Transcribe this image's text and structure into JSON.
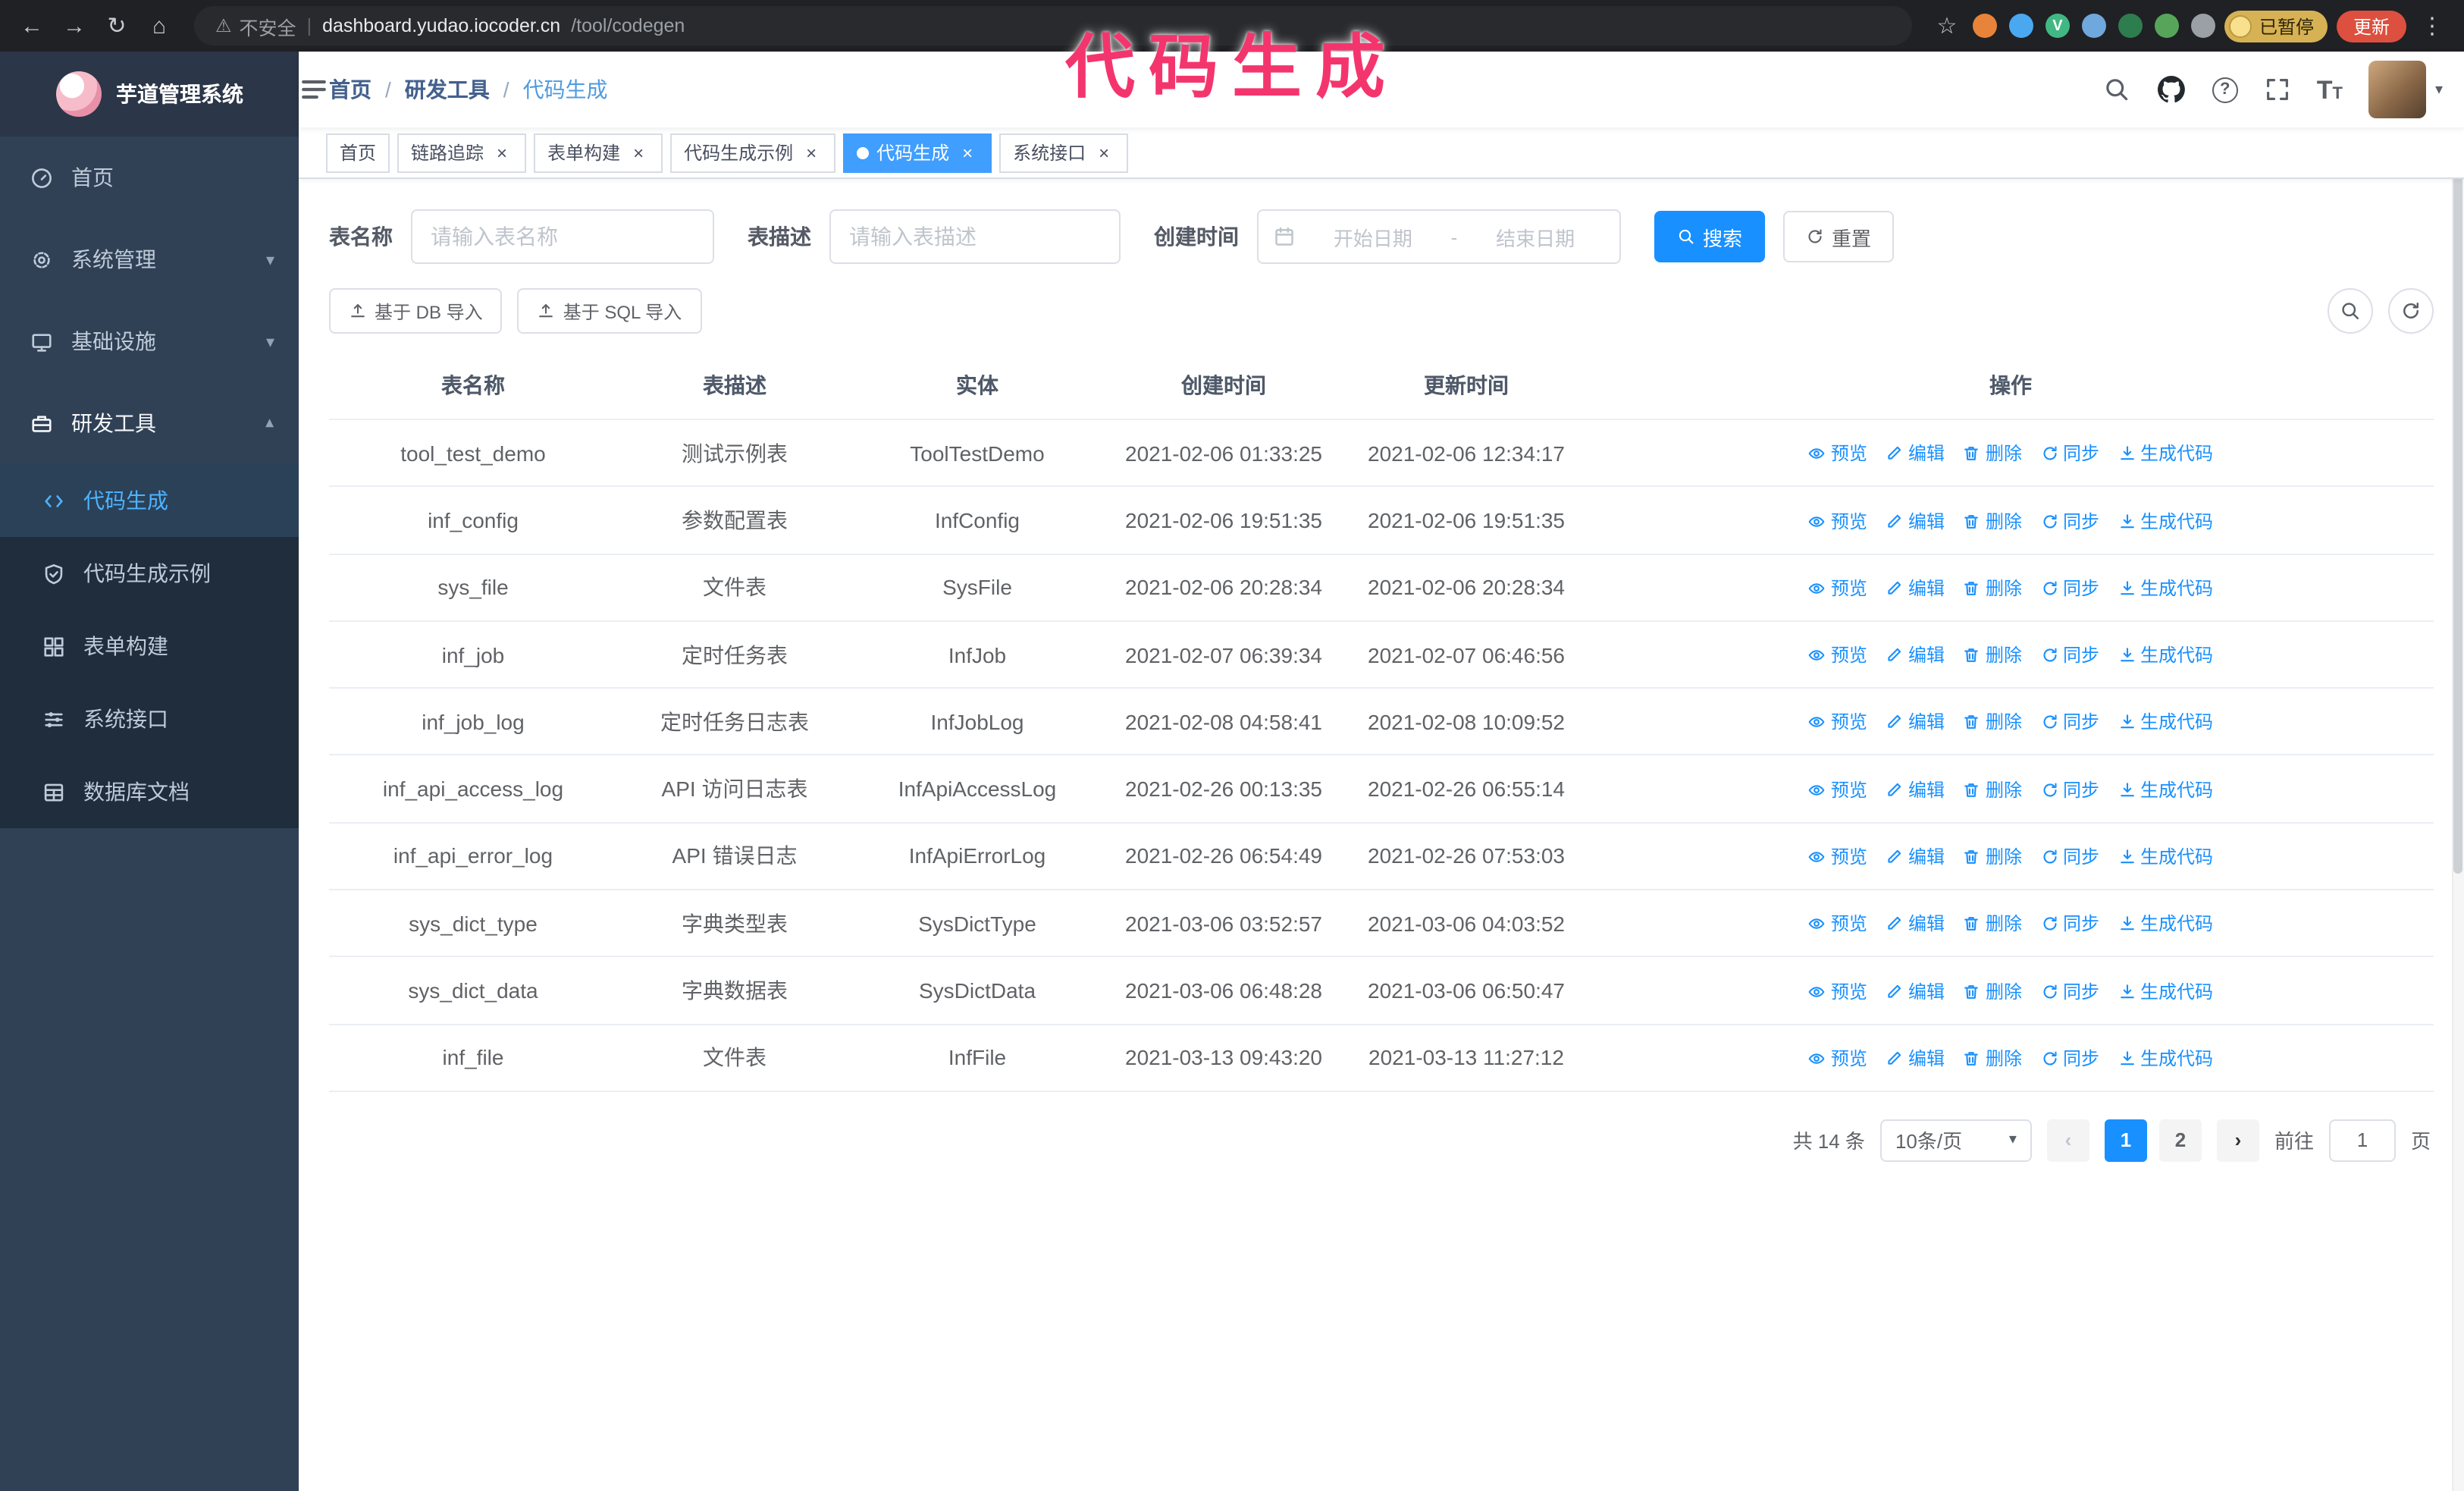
{
  "colors": {
    "primary": "#1890ff",
    "sidebar_bg": "#304156",
    "submenu_bg": "#1f2d3d",
    "active_tab_bg": "#409eff",
    "annotation": "#f4356d"
  },
  "annotation": {
    "text": "代码生成"
  },
  "browser": {
    "security_text": "不安全",
    "url_host": "dashboard.yudao.iocoder.cn",
    "url_path": "/tool/codegen",
    "paused_badge": "已暂停",
    "update_button": "更新",
    "extensions": [
      {
        "name": "fox-extension-icon",
        "color": "#e8833a"
      },
      {
        "name": "water-drop-extension-icon",
        "color": "#4aa8f0"
      },
      {
        "name": "vue-devtools-extension-icon",
        "color": "#41b883",
        "letter": "V"
      },
      {
        "name": "contacts-extension-icon",
        "color": "#6fa8dc"
      },
      {
        "name": "teal-badge-extension-icon",
        "color": "#2e7d4f"
      },
      {
        "name": "leaf-extension-icon",
        "color": "#57a55a"
      },
      {
        "name": "puzzle-extension-icon",
        "color": "#9aa0a6"
      }
    ]
  },
  "sidebar": {
    "logo_title": "芋道管理系统",
    "items": [
      {
        "label": "首页",
        "icon": "dashboard-icon",
        "type": "item"
      },
      {
        "label": "系统管理",
        "icon": "gear-icon",
        "type": "group",
        "state": "collapsed"
      },
      {
        "label": "基础设施",
        "icon": "infra-icon",
        "type": "group",
        "state": "collapsed"
      },
      {
        "label": "研发工具",
        "icon": "tools-icon",
        "type": "group",
        "state": "expanded",
        "children": [
          {
            "label": "代码生成",
            "icon": "code-icon",
            "active": true
          },
          {
            "label": "代码生成示例",
            "icon": "example-icon",
            "active": false
          },
          {
            "label": "表单构建",
            "icon": "form-icon",
            "active": false
          },
          {
            "label": "系统接口",
            "icon": "api-icon",
            "active": false
          },
          {
            "label": "数据库文档",
            "icon": "database-icon",
            "active": false
          }
        ]
      }
    ]
  },
  "header": {
    "breadcrumb": [
      "首页",
      "研发工具",
      "代码生成"
    ]
  },
  "tabs": [
    {
      "label": "首页",
      "closable": false,
      "active": false
    },
    {
      "label": "链路追踪",
      "closable": true,
      "active": false
    },
    {
      "label": "表单构建",
      "closable": true,
      "active": false
    },
    {
      "label": "代码生成示例",
      "closable": true,
      "active": false
    },
    {
      "label": "代码生成",
      "closable": true,
      "active": true
    },
    {
      "label": "系统接口",
      "closable": true,
      "active": false
    }
  ],
  "filters": {
    "table_name": {
      "label": "表名称",
      "placeholder": "请输入表名称",
      "value": ""
    },
    "table_desc": {
      "label": "表描述",
      "placeholder": "请输入表描述",
      "value": ""
    },
    "create_time": {
      "label": "创建时间",
      "start_placeholder": "开始日期",
      "separator": "-",
      "end_placeholder": "结束日期"
    },
    "search_button": "搜索",
    "reset_button": "重置"
  },
  "toolbar": {
    "import_db_button": "基于 DB 导入",
    "import_sql_button": "基于 SQL 导入"
  },
  "table": {
    "columns": [
      "表名称",
      "表描述",
      "实体",
      "创建时间",
      "更新时间",
      "操作"
    ],
    "actions": [
      {
        "name": "preview",
        "label": "预览",
        "icon": "eye-icon"
      },
      {
        "name": "edit",
        "label": "编辑",
        "icon": "edit-icon"
      },
      {
        "name": "delete",
        "label": "删除",
        "icon": "delete-icon"
      },
      {
        "name": "sync",
        "label": "同步",
        "icon": "sync-icon"
      },
      {
        "name": "generate-code",
        "label": "生成代码",
        "icon": "download-icon"
      }
    ],
    "rows": [
      {
        "name": "tool_test_demo",
        "desc": "测试示例表",
        "entity": "ToolTestDemo",
        "create_time": "2021-02-06 01:33:25",
        "update_time": "2021-02-06 12:34:17"
      },
      {
        "name": "inf_config",
        "desc": "参数配置表",
        "entity": "InfConfig",
        "create_time": "2021-02-06 19:51:35",
        "update_time": "2021-02-06 19:51:35"
      },
      {
        "name": "sys_file",
        "desc": "文件表",
        "entity": "SysFile",
        "create_time": "2021-02-06 20:28:34",
        "update_time": "2021-02-06 20:28:34"
      },
      {
        "name": "inf_job",
        "desc": "定时任务表",
        "entity": "InfJob",
        "create_time": "2021-02-07 06:39:34",
        "update_time": "2021-02-07 06:46:56"
      },
      {
        "name": "inf_job_log",
        "desc": "定时任务日志表",
        "entity": "InfJobLog",
        "create_time": "2021-02-08 04:58:41",
        "update_time": "2021-02-08 10:09:52"
      },
      {
        "name": "inf_api_access_log",
        "desc": "API 访问日志表",
        "entity": "InfApiAccessLog",
        "create_time": "2021-02-26 00:13:35",
        "update_time": "2021-02-26 06:55:14"
      },
      {
        "name": "inf_api_error_log",
        "desc": "API 错误日志",
        "entity": "InfApiErrorLog",
        "create_time": "2021-02-26 06:54:49",
        "update_time": "2021-02-26 07:53:03"
      },
      {
        "name": "sys_dict_type",
        "desc": "字典类型表",
        "entity": "SysDictType",
        "create_time": "2021-03-06 03:52:57",
        "update_time": "2021-03-06 04:03:52"
      },
      {
        "name": "sys_dict_data",
        "desc": "字典数据表",
        "entity": "SysDictData",
        "create_time": "2021-03-06 06:48:28",
        "update_time": "2021-03-06 06:50:47"
      },
      {
        "name": "inf_file",
        "desc": "文件表",
        "entity": "InfFile",
        "create_time": "2021-03-13 09:43:20",
        "update_time": "2021-03-13 11:27:12"
      }
    ]
  },
  "pagination": {
    "total_text": "共 14 条",
    "page_size_text": "10条/页",
    "pages": [
      {
        "label": "1",
        "active": true
      },
      {
        "label": "2",
        "active": false
      }
    ],
    "goto_label": "前往",
    "goto_value": "1",
    "goto_suffix": "页"
  }
}
